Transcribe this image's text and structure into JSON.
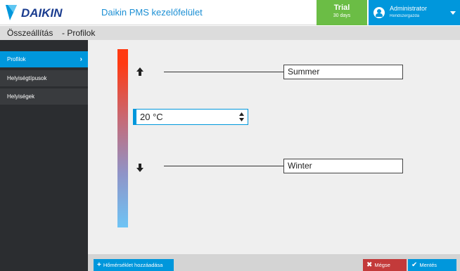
{
  "header": {
    "logo_text": "DAIKIN",
    "app_title": "Daikin PMS kezelőfelület",
    "trial_label": "Trial",
    "trial_days": "30 days",
    "user_name": "Administrator",
    "user_role": "Rendszergazda"
  },
  "breadcrumb": {
    "root": "Összeállítás",
    "current": "- Profilok"
  },
  "sidebar": {
    "items": [
      {
        "label": "Profilok",
        "active": true
      },
      {
        "label": "Helyiségtípusok",
        "active": false
      },
      {
        "label": "Helyiségek",
        "active": false
      }
    ]
  },
  "profile": {
    "summer_label": "Summer",
    "winter_label": "Winter",
    "temperature": "20 °C"
  },
  "footer": {
    "add_label": "Hőmérséklet hozzáadása",
    "cancel_label": "Mégse",
    "save_label": "Mentés"
  },
  "colors": {
    "accent": "#0097dc",
    "trial": "#6bbd45",
    "cancel": "#c33a3a",
    "sidebar": "#2b2d30"
  }
}
